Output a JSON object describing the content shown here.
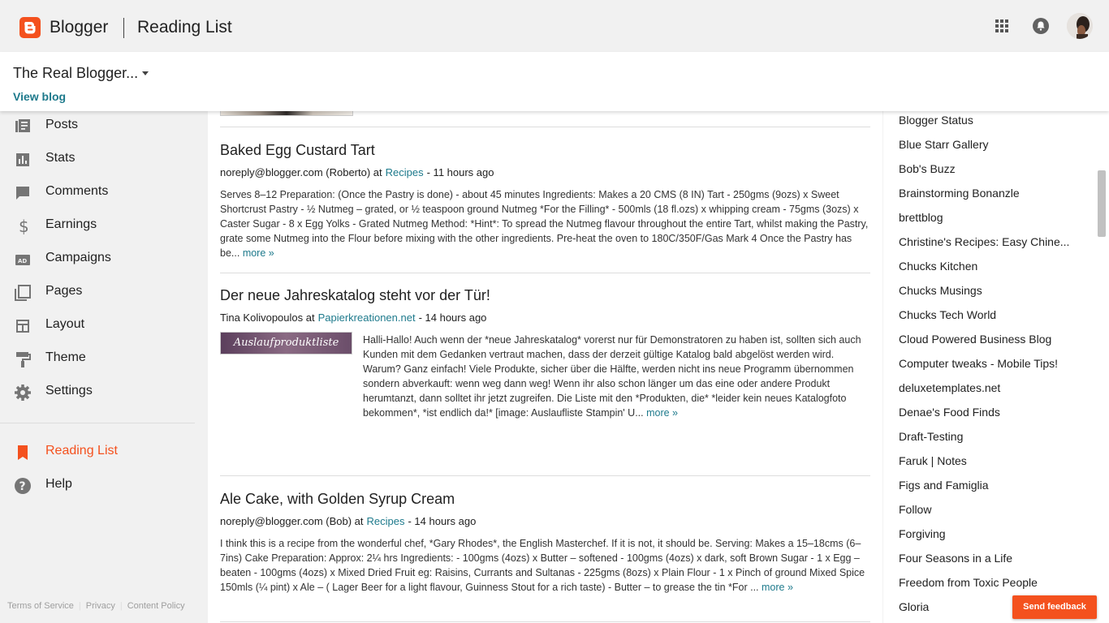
{
  "header": {
    "brand": "Blogger",
    "section": "Reading List"
  },
  "blogbar": {
    "blog_name": "The Real Blogger...",
    "view_blog": "View blog"
  },
  "sidebar": {
    "items": [
      {
        "label": "Posts",
        "icon": "posts-icon"
      },
      {
        "label": "Stats",
        "icon": "stats-icon"
      },
      {
        "label": "Comments",
        "icon": "comments-icon"
      },
      {
        "label": "Earnings",
        "icon": "dollar-icon"
      },
      {
        "label": "Campaigns",
        "icon": "campaigns-icon"
      },
      {
        "label": "Pages",
        "icon": "pages-icon"
      },
      {
        "label": "Layout",
        "icon": "layout-icon"
      },
      {
        "label": "Theme",
        "icon": "paint-roller-icon"
      },
      {
        "label": "Settings",
        "icon": "gear-icon"
      }
    ],
    "reading_list": "Reading List",
    "help": "Help",
    "footer": [
      "Terms of Service",
      "Privacy",
      "Content Policy"
    ]
  },
  "posts": [
    {
      "title": "Baked Egg Custard Tart",
      "author": "noreply@blogger.com (Roberto) at",
      "blog": "Recipes",
      "time": "- 11 hours ago",
      "body": "Serves 8–12 Preparation: (Once the Pastry is done) - about 45 minutes Ingredients: Makes a 20 CMS (8 IN) Tart - 250gms (9ozs) x Sweet Shortcrust Pastry - ½ Nutmeg – grated, or ½ teaspoon ground Nutmeg *For the Filling* - 500mls (18 fl.ozs) x whipping cream - 75gms (3ozs) x Caster Sugar - 8 x Egg Yolks - Grated Nutmeg Method: *Hint*: To spread the Nutmeg flavour throughout the entire Tart, whilst making the Pastry, grate some Nutmeg into the Flour before mixing with the other ingredients. Pre-heat the oven to 180C/350F/Gas Mark 4 Once the Pastry has be...",
      "more": "more »"
    },
    {
      "title": "Der neue Jahreskatalog steht vor der Tür!",
      "author": "Tina Kolivopoulos at",
      "blog": "Papierkreationen.net",
      "time": "- 14 hours ago",
      "image_text": "Auslaufproduktliste",
      "body": "Halli-Hallo! Auch wenn der *neue Jahreskatalog* vorerst nur für Demonstratoren zu haben ist, sollten sich auch Kunden mit dem Gedanken vertraut machen, dass der derzeit gültige Katalog bald abgelöst werden wird. Warum? Ganz einfach! Viele Produkte, sicher über die Hälfte, werden nicht ins neue Programm übernommen sondern abverkauft: wenn weg dann weg! Wenn ihr also schon länger um das eine oder andere Produkt herumtanzt, dann solltet ihr jetzt zugreifen. Die Liste mit den *Produkten, die* *leider kein neues Katalogfoto bekommen*, *ist endlich da!* [image: Auslaufliste Stampin' U...",
      "more": "more »"
    },
    {
      "title": "Ale Cake, with Golden Syrup Cream",
      "author": "noreply@blogger.com (Bob) at",
      "blog": "Recipes",
      "time": "- 14 hours ago",
      "body": "I think this is a recipe from the wonderful chef, *Gary Rhodes*, the English Masterchef. If it is not, it should be. Serving: Makes a 15–18cms (6–7ins) Cake Preparation: Approx: 2¼ hrs Ingredients: - 100gms (4ozs) x Butter – softened - 100gms (4ozs) x dark, soft Brown Sugar - 1 x Egg – beaten - 100gms (4ozs) x Mixed Dried Fruit eg: Raisins, Currants and Sultanas - 225gms (8ozs) x Plain Flour - 1 x Pinch of ground Mixed Spice 150mls (¼ pint) x Ale – ( Lager Beer for a light flavour, Guinness Stout for a rich taste) - Butter – to grease the tin *For ...",
      "more": "more »"
    }
  ],
  "blogs": [
    "Blogger Status",
    "Blue Starr Gallery",
    "Bob's Buzz",
    "Brainstorming Bonanzle",
    "brettblog",
    "Christine's Recipes: Easy Chine...",
    "Chucks Kitchen",
    "Chucks Musings",
    "Chucks Tech World",
    "Cloud Powered Business Blog",
    "Computer tweaks - Mobile Tips!",
    "deluxetemplates.net",
    "Denae's Food Finds",
    "Draft-Testing",
    "Faruk | Notes",
    "Figs and Famiglia",
    "Follow",
    "Forgiving",
    "Four Seasons in a Life",
    "Freedom from Toxic People",
    "Gloria"
  ],
  "feedback": "Send feedback",
  "colors": {
    "accent": "#f4511e",
    "link": "#1e7a8c"
  }
}
